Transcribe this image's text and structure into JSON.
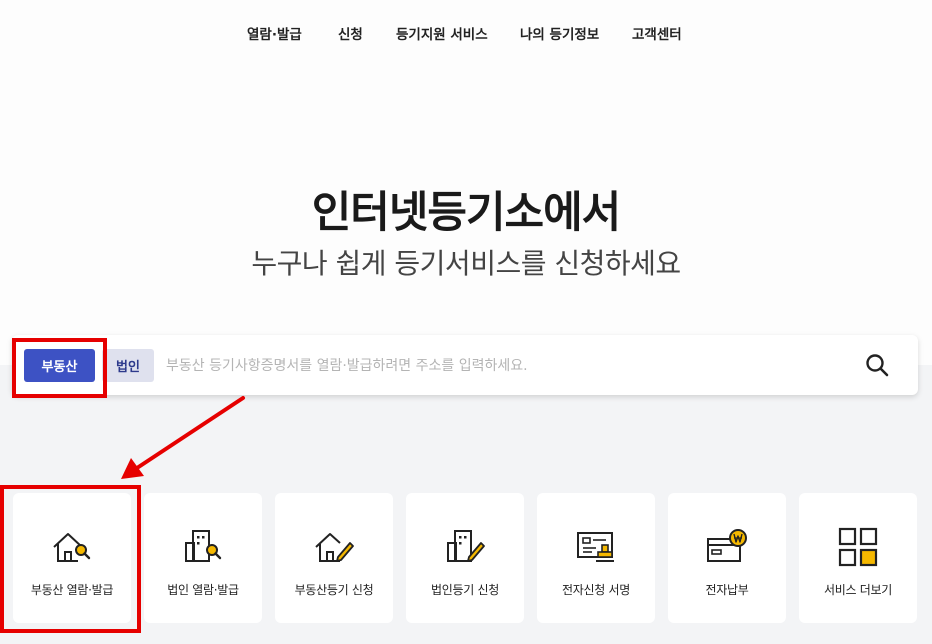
{
  "nav": {
    "items": [
      "열람·발급",
      "신청",
      "등기지원 서비스",
      "나의 등기정보",
      "고객센터"
    ]
  },
  "hero": {
    "title": "인터넷등기소에서",
    "subtitle": "누구나 쉽게 등기서비스를 신청하세요"
  },
  "search": {
    "tabs": [
      "부동산",
      "법인"
    ],
    "active_tab": "부동산",
    "placeholder": "부동산 등기사항증명서를 열람·발급하려면 주소를 입력하세요.",
    "value": ""
  },
  "services": [
    {
      "label": "부동산 열람·발급",
      "icon": "house-search-icon"
    },
    {
      "label": "법인 열람·발급",
      "icon": "building-search-icon"
    },
    {
      "label": "부동산등기 신청",
      "icon": "house-pen-icon"
    },
    {
      "label": "법인등기 신청",
      "icon": "building-pen-icon"
    },
    {
      "label": "전자신청 서명",
      "icon": "document-stamp-icon"
    },
    {
      "label": "전자납부",
      "icon": "card-won-icon"
    },
    {
      "label": "서비스 더보기",
      "icon": "grid-more-icon"
    }
  ],
  "colors": {
    "primary": "#3d52c4",
    "accent": "#f5b800",
    "annotation": "#e60000",
    "lower_bg": "#f3f4f6"
  }
}
